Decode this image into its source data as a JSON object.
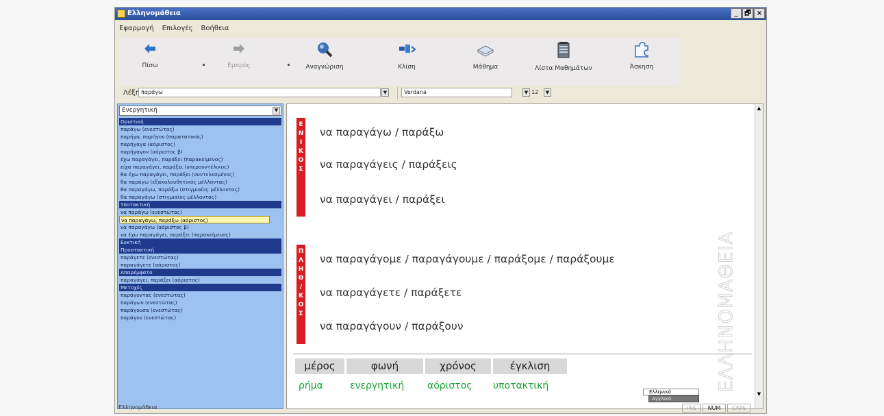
{
  "window": {
    "title": "Ελληνομάθεια",
    "controls": [
      "_",
      "🗗",
      "×"
    ]
  },
  "menu": [
    "Εφαρμογή",
    "Επιλογές",
    "Βοήθεια"
  ],
  "toolbar": {
    "back": "Πίσω",
    "forward": "Εμπρός",
    "recognition": "Αναγνώριση",
    "inflection": "Κλίση",
    "lesson": "Μάθημα",
    "lesson_list": "Λίστα Μαθημάτων",
    "exercise": "Άσκηση"
  },
  "word_bar": {
    "label": "Λέξη",
    "value": "παράγω",
    "font": "Verdana",
    "size": "12"
  },
  "left_panel": {
    "voice": "Ενεργητική",
    "forms": [
      {
        "text": "Οριστική",
        "type": "hdr"
      },
      {
        "text": "παράγω (ενεστώτας)",
        "type": ""
      },
      {
        "text": "παρήγα, παρήγον (παρατατικός)",
        "type": ""
      },
      {
        "text": "παρήγαγα (αόριστος)",
        "type": ""
      },
      {
        "text": "παρήγαγον (αόριστος β)",
        "type": ""
      },
      {
        "text": "έχω παραγάγει, παράξει (παρακείμενος)",
        "type": ""
      },
      {
        "text": "είχα παραγάγει, παράξει (υπερσυντέλικος)",
        "type": ""
      },
      {
        "text": "θα έχω παραγάγει, παράξει (συντελεσμένος)",
        "type": ""
      },
      {
        "text": "θα παράγω (εξακολουθητικός μέλλοντας)",
        "type": ""
      },
      {
        "text": "θα παραγάγω, παράξω (στιγμιαίος μέλλοντας)",
        "type": ""
      },
      {
        "text": "θα παραγάγω (στιγμιαίος μέλλοντας)",
        "type": ""
      },
      {
        "text": "Υποτακτική",
        "type": "hdr"
      },
      {
        "text": "να παράγω (ενεστώτας)",
        "type": ""
      },
      {
        "text": "να παραγάγω, παράξω (αόριστος)",
        "type": "sel"
      },
      {
        "text": "να παραγάγω (αόριστος β)",
        "type": ""
      },
      {
        "text": "να έχω παραγάγει, παράξει (παρακείμενος)",
        "type": ""
      },
      {
        "text": "Ευκτική",
        "type": "hdr"
      },
      {
        "text": "Προστακτική",
        "type": "hdr"
      },
      {
        "text": "παράγετε (ενεστώτας)",
        "type": ""
      },
      {
        "text": "παραγάγετε (αόριστος)",
        "type": ""
      },
      {
        "text": "Απαρέμφατο",
        "type": "hdr"
      },
      {
        "text": "παραγάγει, παράξει (αόριστος)",
        "type": ""
      },
      {
        "text": "Μετοχές",
        "type": "hdr"
      },
      {
        "text": "παράγοντας (ενεστώτας)",
        "type": ""
      },
      {
        "text": "παράγων (ενεστώτας)",
        "type": ""
      },
      {
        "text": "παράγουσα (ενεστώτας)",
        "type": ""
      },
      {
        "text": "παράγον (ενεστώτας)",
        "type": ""
      }
    ]
  },
  "main": {
    "singular_label": [
      "Ε",
      "Ν",
      "Ι",
      "Κ",
      "Ο",
      "Σ"
    ],
    "plural_label": [
      "Π",
      "Λ",
      "Η",
      "Θ",
      "/",
      "Κ",
      "Ο",
      "Σ"
    ],
    "singular": [
      "να παραγάγω / παράξω",
      "να παραγάγεις / παράξεις",
      "να παραγάγει / παράξει"
    ],
    "plural": [
      "να παραγάγομε / παραγάγουμε / παράξομε / παράξουμε",
      "να παραγάγετε / παράξετε",
      "να παραγάγουν / παράξουν"
    ],
    "watermark": "ΕΛΛΗΝΟΜΑΘΕΙΑ",
    "table_headers": [
      "μέρος",
      "φωνή",
      "χρόνος",
      "έγκλιση"
    ],
    "table_values": [
      "ρήμα",
      "ενεργητική",
      "αόριστος",
      "υποτακτική"
    ],
    "lang_toggle": [
      "Ελληνικά",
      "Αγγλικά"
    ]
  },
  "statusbar": {
    "text": "Ελληνομάθεια",
    "ins": "INS",
    "num": "NUM",
    "caps": "CAPS"
  },
  "colors": {
    "accent_red": "#d81e23",
    "value_green": "#17a434",
    "panel_blue": "#9dc2ef",
    "header_navy": "#1f3a8c"
  }
}
